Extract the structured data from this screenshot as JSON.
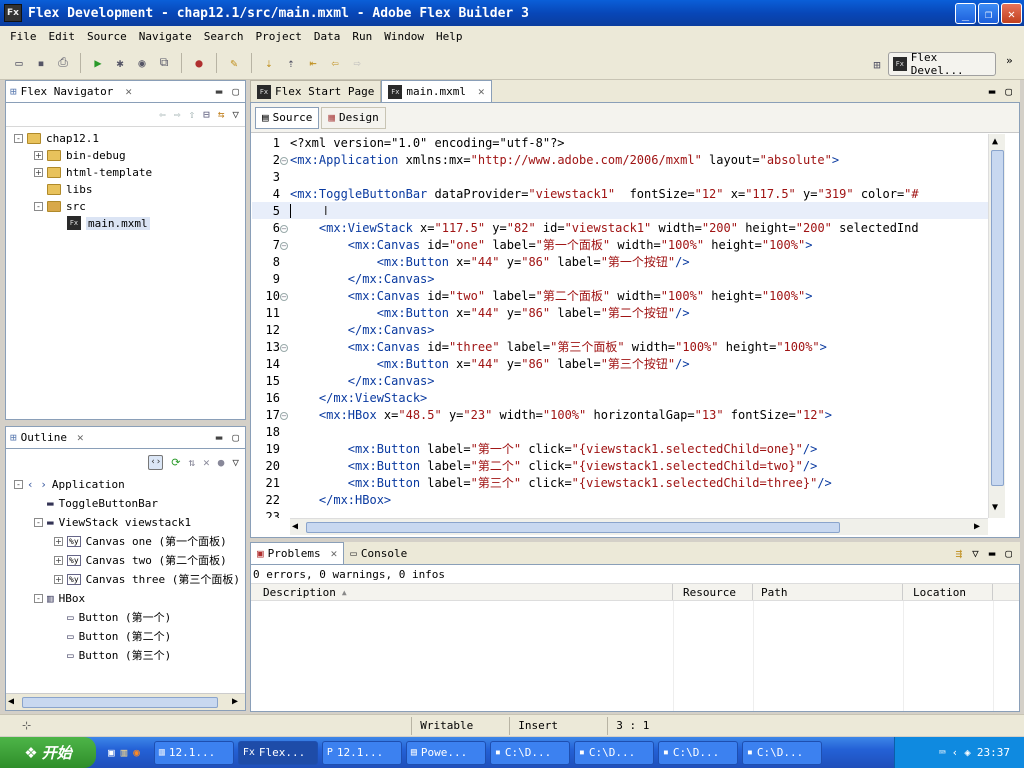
{
  "window": {
    "title": "Flex Development - chap12.1/src/main.mxml - Adobe Flex Builder 3",
    "app_icon": "Fx"
  },
  "menu": [
    "File",
    "Edit",
    "Source",
    "Navigate",
    "Search",
    "Project",
    "Data",
    "Run",
    "Window",
    "Help"
  ],
  "perspective": {
    "label": "Flex Devel..."
  },
  "navigator": {
    "tab_label": "Flex Navigator",
    "items": [
      {
        "label": "chap12.1",
        "indent": 0,
        "expander": "-",
        "icon": "project-folder"
      },
      {
        "label": "bin-debug",
        "indent": 1,
        "expander": "+",
        "icon": "folder"
      },
      {
        "label": "html-template",
        "indent": 1,
        "expander": "+",
        "icon": "folder"
      },
      {
        "label": "libs",
        "indent": 1,
        "expander": "",
        "icon": "folder"
      },
      {
        "label": "src",
        "indent": 1,
        "expander": "-",
        "icon": "source-folder"
      },
      {
        "label": "main.mxml",
        "indent": 2,
        "expander": "",
        "icon": "mxml-file"
      }
    ]
  },
  "outline": {
    "tab_label": "Outline",
    "items": [
      {
        "label": "Application",
        "indent": 0,
        "expander": "-",
        "icon": "application"
      },
      {
        "label": "ToggleButtonBar",
        "indent": 1,
        "expander": "",
        "icon": "component"
      },
      {
        "label": "ViewStack viewstack1",
        "indent": 1,
        "expander": "-",
        "icon": "component"
      },
      {
        "label": "Canvas one (第一个面板)",
        "indent": 2,
        "expander": "+",
        "icon": "canvas"
      },
      {
        "label": "Canvas two (第二个面板)",
        "indent": 2,
        "expander": "+",
        "icon": "canvas"
      },
      {
        "label": "Canvas three (第三个面板)",
        "indent": 2,
        "expander": "+",
        "icon": "canvas"
      },
      {
        "label": "HBox",
        "indent": 1,
        "expander": "-",
        "icon": "hbox"
      },
      {
        "label": "Button (第一个)",
        "indent": 2,
        "expander": "",
        "icon": "button"
      },
      {
        "label": "Button (第二个)",
        "indent": 2,
        "expander": "",
        "icon": "button"
      },
      {
        "label": "Button (第三个)",
        "indent": 2,
        "expander": "",
        "icon": "button"
      }
    ]
  },
  "editor": {
    "tabs": [
      {
        "label": "Flex Start Page",
        "active": false
      },
      {
        "label": "main.mxml",
        "active": true
      }
    ],
    "mode_buttons": [
      {
        "label": "Source",
        "active": true
      },
      {
        "label": "Design",
        "active": false
      }
    ],
    "lines": [
      {
        "n": "1",
        "fold": false,
        "segs": [
          {
            "t": "<?xml version=\"1.0\" encoding=\"utf-8\"?>",
            "c": "attr"
          }
        ]
      },
      {
        "n": "2",
        "fold": true,
        "segs": [
          {
            "t": "<mx:Application ",
            "c": "tag"
          },
          {
            "t": "xmlns:mx=",
            "c": "attr"
          },
          {
            "t": "\"http://www.adobe.com/2006/mxml\"",
            "c": "val"
          },
          {
            "t": " layout=",
            "c": "attr"
          },
          {
            "t": "\"absolute\"",
            "c": "val"
          },
          {
            "t": ">",
            "c": "tag"
          }
        ]
      },
      {
        "n": "3",
        "fold": false,
        "segs": []
      },
      {
        "n": "4",
        "fold": false,
        "segs": [
          {
            "t": "<mx:ToggleButtonBar ",
            "c": "tag"
          },
          {
            "t": "dataProvider=",
            "c": "attr"
          },
          {
            "t": "\"viewstack1\"",
            "c": "val"
          },
          {
            "t": "  fontSize=",
            "c": "attr"
          },
          {
            "t": "\"12\"",
            "c": "val"
          },
          {
            "t": " x=",
            "c": "attr"
          },
          {
            "t": "\"117.5\"",
            "c": "val"
          },
          {
            "t": " y=",
            "c": "attr"
          },
          {
            "t": "\"319\"",
            "c": "val"
          },
          {
            "t": " color=",
            "c": "attr"
          },
          {
            "t": "\"#",
            "c": "val"
          }
        ]
      },
      {
        "n": "5",
        "fold": false,
        "segs": []
      },
      {
        "n": "6",
        "fold": true,
        "segs": [
          {
            "t": "    <mx:ViewStack ",
            "c": "tag"
          },
          {
            "t": "x=",
            "c": "attr"
          },
          {
            "t": "\"117.5\"",
            "c": "val"
          },
          {
            "t": " y=",
            "c": "attr"
          },
          {
            "t": "\"82\"",
            "c": "val"
          },
          {
            "t": " id=",
            "c": "attr"
          },
          {
            "t": "\"viewstack1\"",
            "c": "val"
          },
          {
            "t": " width=",
            "c": "attr"
          },
          {
            "t": "\"200\"",
            "c": "val"
          },
          {
            "t": " height=",
            "c": "attr"
          },
          {
            "t": "\"200\"",
            "c": "val"
          },
          {
            "t": " selectedInd",
            "c": "attr"
          }
        ]
      },
      {
        "n": "7",
        "fold": true,
        "segs": [
          {
            "t": "        <mx:Canvas ",
            "c": "tag"
          },
          {
            "t": "id=",
            "c": "attr"
          },
          {
            "t": "\"one\"",
            "c": "val"
          },
          {
            "t": " label=",
            "c": "attr"
          },
          {
            "t": "\"第一个面板\"",
            "c": "val"
          },
          {
            "t": " width=",
            "c": "attr"
          },
          {
            "t": "\"100%\"",
            "c": "val"
          },
          {
            "t": " height=",
            "c": "attr"
          },
          {
            "t": "\"100%\"",
            "c": "val"
          },
          {
            "t": ">",
            "c": "tag"
          }
        ]
      },
      {
        "n": "8",
        "fold": false,
        "segs": [
          {
            "t": "            <mx:Button ",
            "c": "tag"
          },
          {
            "t": "x=",
            "c": "attr"
          },
          {
            "t": "\"44\"",
            "c": "val"
          },
          {
            "t": " y=",
            "c": "attr"
          },
          {
            "t": "\"86\"",
            "c": "val"
          },
          {
            "t": " label=",
            "c": "attr"
          },
          {
            "t": "\"第一个按钮\"",
            "c": "val"
          },
          {
            "t": "/>",
            "c": "tag"
          }
        ]
      },
      {
        "n": "9",
        "fold": false,
        "segs": [
          {
            "t": "        </mx:Canvas>",
            "c": "tag"
          }
        ]
      },
      {
        "n": "10",
        "fold": true,
        "segs": [
          {
            "t": "        <mx:Canvas ",
            "c": "tag"
          },
          {
            "t": "id=",
            "c": "attr"
          },
          {
            "t": "\"two\"",
            "c": "val"
          },
          {
            "t": " label=",
            "c": "attr"
          },
          {
            "t": "\"第二个面板\"",
            "c": "val"
          },
          {
            "t": " width=",
            "c": "attr"
          },
          {
            "t": "\"100%\"",
            "c": "val"
          },
          {
            "t": " height=",
            "c": "attr"
          },
          {
            "t": "\"100%\"",
            "c": "val"
          },
          {
            "t": ">",
            "c": "tag"
          }
        ]
      },
      {
        "n": "11",
        "fold": false,
        "segs": [
          {
            "t": "            <mx:Button ",
            "c": "tag"
          },
          {
            "t": "x=",
            "c": "attr"
          },
          {
            "t": "\"44\"",
            "c": "val"
          },
          {
            "t": " y=",
            "c": "attr"
          },
          {
            "t": "\"86\"",
            "c": "val"
          },
          {
            "t": " label=",
            "c": "attr"
          },
          {
            "t": "\"第二个按钮\"",
            "c": "val"
          },
          {
            "t": "/>",
            "c": "tag"
          }
        ]
      },
      {
        "n": "12",
        "fold": false,
        "segs": [
          {
            "t": "        </mx:Canvas>",
            "c": "tag"
          }
        ]
      },
      {
        "n": "13",
        "fold": true,
        "segs": [
          {
            "t": "        <mx:Canvas ",
            "c": "tag"
          },
          {
            "t": "id=",
            "c": "attr"
          },
          {
            "t": "\"three\"",
            "c": "val"
          },
          {
            "t": " label=",
            "c": "attr"
          },
          {
            "t": "\"第三个面板\"",
            "c": "val"
          },
          {
            "t": " width=",
            "c": "attr"
          },
          {
            "t": "\"100%\"",
            "c": "val"
          },
          {
            "t": " height=",
            "c": "attr"
          },
          {
            "t": "\"100%\"",
            "c": "val"
          },
          {
            "t": ">",
            "c": "tag"
          }
        ]
      },
      {
        "n": "14",
        "fold": false,
        "segs": [
          {
            "t": "            <mx:Button ",
            "c": "tag"
          },
          {
            "t": "x=",
            "c": "attr"
          },
          {
            "t": "\"44\"",
            "c": "val"
          },
          {
            "t": " y=",
            "c": "attr"
          },
          {
            "t": "\"86\"",
            "c": "val"
          },
          {
            "t": " label=",
            "c": "attr"
          },
          {
            "t": "\"第三个按钮\"",
            "c": "val"
          },
          {
            "t": "/>",
            "c": "tag"
          }
        ]
      },
      {
        "n": "15",
        "fold": false,
        "segs": [
          {
            "t": "        </mx:Canvas>",
            "c": "tag"
          }
        ]
      },
      {
        "n": "16",
        "fold": false,
        "segs": [
          {
            "t": "    </mx:ViewStack>",
            "c": "tag"
          }
        ]
      },
      {
        "n": "17",
        "fold": true,
        "segs": [
          {
            "t": "    <mx:HBox ",
            "c": "tag"
          },
          {
            "t": "x=",
            "c": "attr"
          },
          {
            "t": "\"48.5\"",
            "c": "val"
          },
          {
            "t": " y=",
            "c": "attr"
          },
          {
            "t": "\"23\"",
            "c": "val"
          },
          {
            "t": " width=",
            "c": "attr"
          },
          {
            "t": "\"100%\"",
            "c": "val"
          },
          {
            "t": " horizontalGap=",
            "c": "attr"
          },
          {
            "t": "\"13\"",
            "c": "val"
          },
          {
            "t": " fontSize=",
            "c": "attr"
          },
          {
            "t": "\"12\"",
            "c": "val"
          },
          {
            "t": ">",
            "c": "tag"
          }
        ]
      },
      {
        "n": "18",
        "fold": false,
        "segs": []
      },
      {
        "n": "19",
        "fold": false,
        "segs": [
          {
            "t": "        <mx:Button ",
            "c": "tag"
          },
          {
            "t": "label=",
            "c": "attr"
          },
          {
            "t": "\"第一个\"",
            "c": "val"
          },
          {
            "t": " click=",
            "c": "attr"
          },
          {
            "t": "\"{viewstack1.selectedChild=one}\"",
            "c": "val"
          },
          {
            "t": "/>",
            "c": "tag"
          }
        ]
      },
      {
        "n": "20",
        "fold": false,
        "segs": [
          {
            "t": "        <mx:Button ",
            "c": "tag"
          },
          {
            "t": "label=",
            "c": "attr"
          },
          {
            "t": "\"第二个\"",
            "c": "val"
          },
          {
            "t": " click=",
            "c": "attr"
          },
          {
            "t": "\"{viewstack1.selectedChild=two}\"",
            "c": "val"
          },
          {
            "t": "/>",
            "c": "tag"
          }
        ]
      },
      {
        "n": "21",
        "fold": false,
        "segs": [
          {
            "t": "        <mx:Button ",
            "c": "tag"
          },
          {
            "t": "label=",
            "c": "attr"
          },
          {
            "t": "\"第三个\"",
            "c": "val"
          },
          {
            "t": " click=",
            "c": "attr"
          },
          {
            "t": "\"{viewstack1.selectedChild=three}\"",
            "c": "val"
          },
          {
            "t": "/>",
            "c": "tag"
          }
        ]
      },
      {
        "n": "22",
        "fold": false,
        "segs": [
          {
            "t": "    </mx:HBox>",
            "c": "tag"
          }
        ]
      },
      {
        "n": "23",
        "fold": false,
        "segs": []
      }
    ]
  },
  "problems": {
    "tabs": [
      {
        "label": "Problems",
        "active": true
      },
      {
        "label": "Console",
        "active": false
      }
    ],
    "summary": "0 errors, 0 warnings, 0 infos",
    "columns": [
      "Description",
      "Resource",
      "Path",
      "Location"
    ]
  },
  "status": {
    "writable": "Writable",
    "insert": "Insert",
    "position": "3 : 1"
  },
  "taskbar": {
    "start_label": "开始",
    "tasks": [
      "12.1...",
      "Flex...",
      "12.1...",
      "Powe...",
      "C:\\D...",
      "C:\\D...",
      "C:\\D...",
      "C:\\D..."
    ],
    "active_task": 1,
    "clock": "23:37"
  },
  "colors": {
    "tag": "#0a3aa0",
    "value": "#a01414",
    "title_bar": "#0a4ec8",
    "taskbar": "#2461d6"
  }
}
